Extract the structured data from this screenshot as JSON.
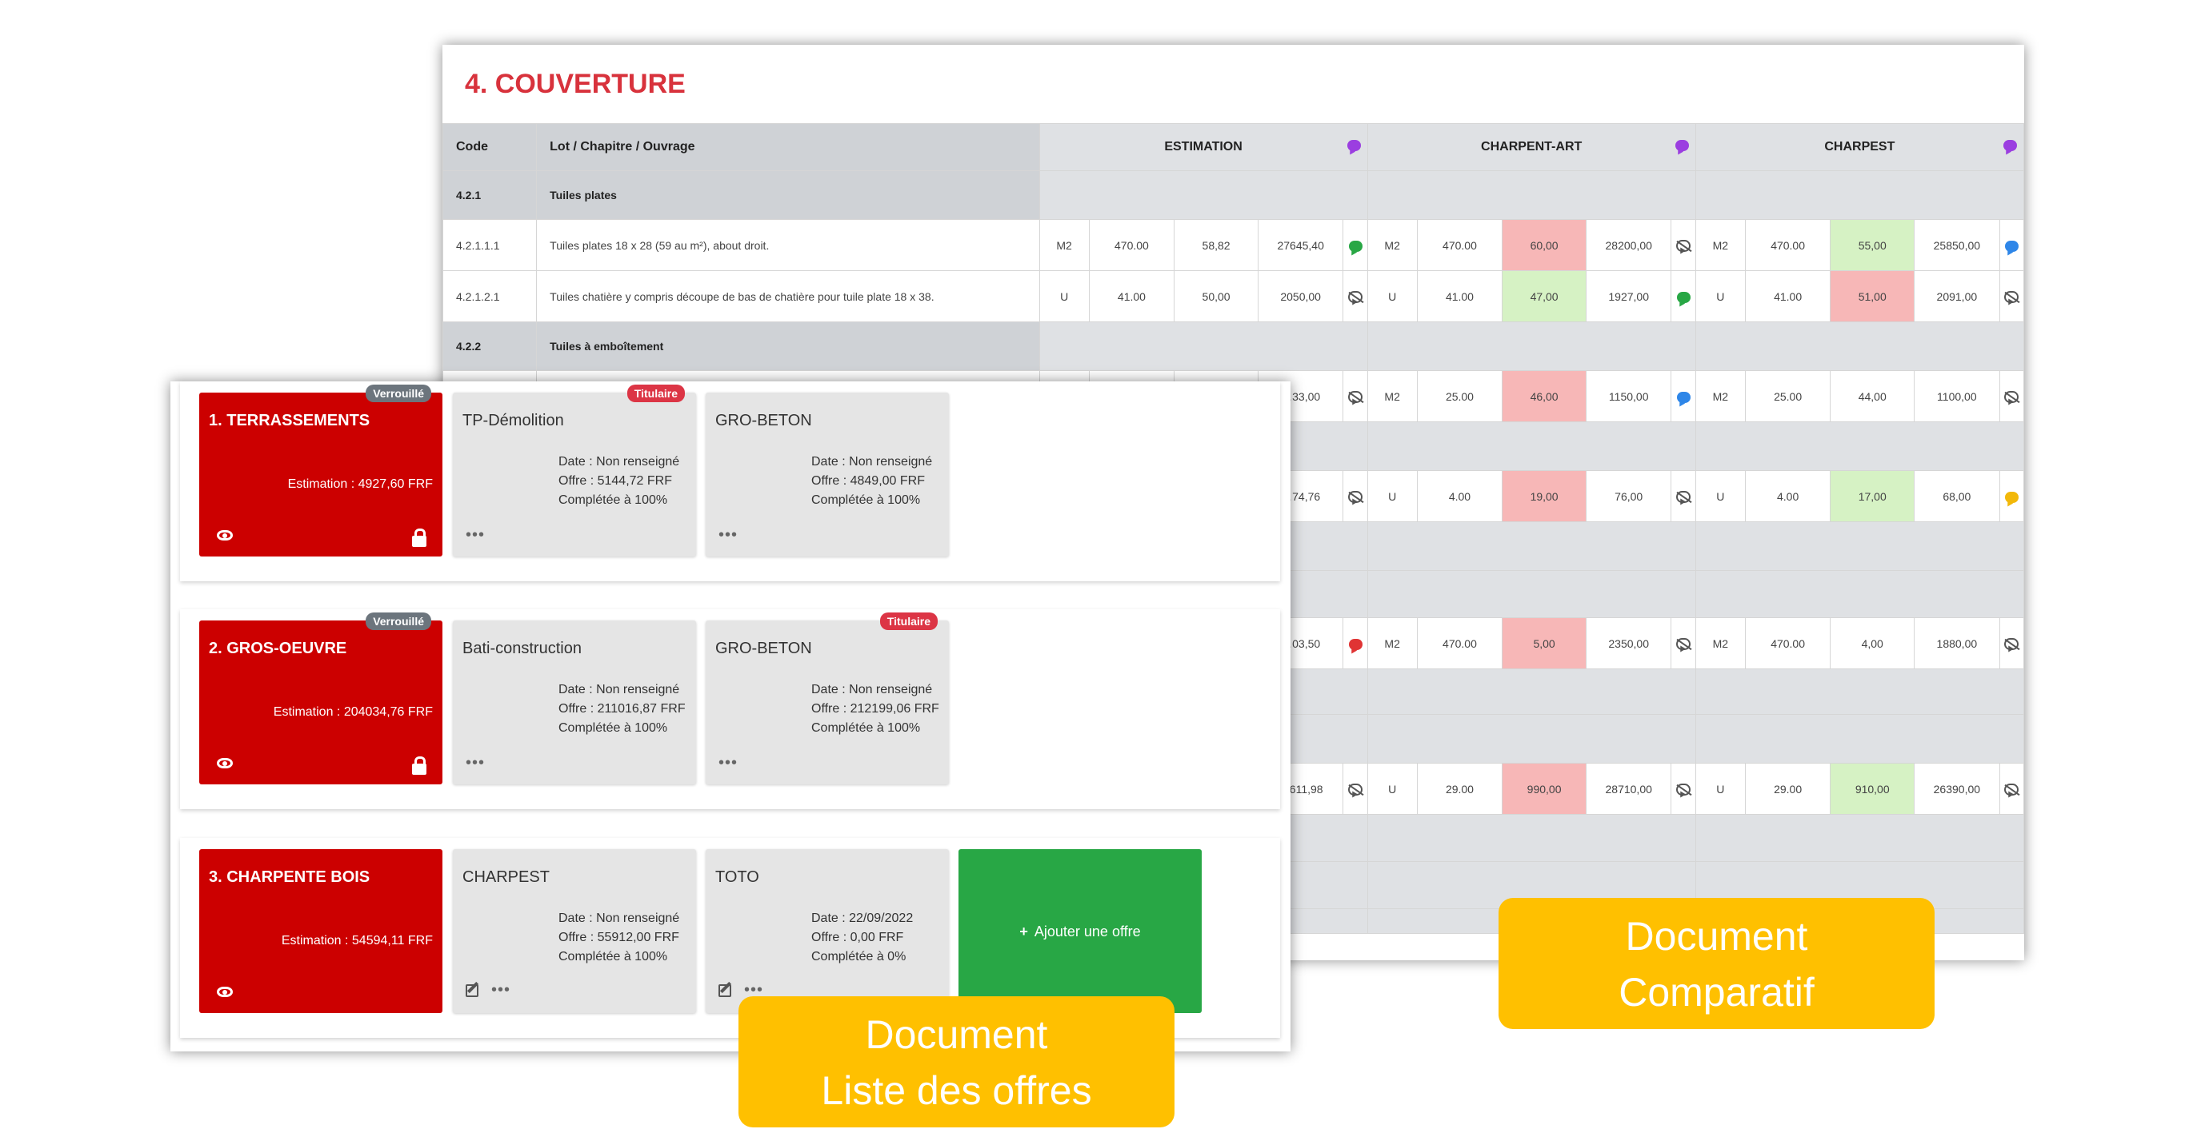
{
  "comparatif": {
    "title": "4. COUVERTURE",
    "headers": {
      "code": "Code",
      "lot": "Lot / Chapitre / Ouvrage"
    },
    "companies": [
      {
        "name": "ESTIMATION",
        "icon": "purple-comment-icon"
      },
      {
        "name": "CHARPENT-ART",
        "icon": "purple-comment-icon"
      },
      {
        "name": "CHARPEST",
        "icon": "purple-comment-icon"
      }
    ],
    "chapters": [
      {
        "code": "4.2.1",
        "label": "Tuiles plates"
      },
      {
        "code": "4.2.2",
        "label": "Tuiles à emboîtement"
      }
    ],
    "items": [
      {
        "code": "4.2.1.1.1",
        "label": "Tuiles plates 18 x 28 (59 au m²), about droit.",
        "estimation": {
          "unit": "M2",
          "qty": "470.00",
          "pu": "58,82",
          "total": "27645,40",
          "icon": "green"
        },
        "charpentart": {
          "unit": "M2",
          "qty": "470.00",
          "pu": "60,00",
          "pu_color": "red",
          "total": "28200,00",
          "icon": "none"
        },
        "charpest": {
          "unit": "M2",
          "qty": "470.00",
          "pu": "55,00",
          "pu_color": "green",
          "total": "25850,00",
          "icon": "blue"
        }
      },
      {
        "code": "4.2.1.2.1",
        "label": "Tuiles chatière y compris découpe de bas de chatière pour tuile plate 18 x 38.",
        "estimation": {
          "unit": "U",
          "qty": "41.00",
          "pu": "50,00",
          "total": "2050,00",
          "icon": "none"
        },
        "charpentart": {
          "unit": "U",
          "qty": "41.00",
          "pu": "47,00",
          "pu_color": "green",
          "total": "1927,00",
          "icon": "green"
        },
        "charpest": {
          "unit": "U",
          "qty": "41.00",
          "pu": "51,00",
          "pu_color": "red",
          "total": "2091,00",
          "icon": "none"
        }
      }
    ],
    "partial_rows": [
      {
        "est_total": "…33,00",
        "est_icon": "none",
        "c1": {
          "unit": "M2",
          "qty": "25.00",
          "pu": "46,00",
          "pu_color": "red",
          "total": "1150,00",
          "icon": "blue"
        },
        "c2": {
          "unit": "M2",
          "qty": "25.00",
          "pu": "44,00",
          "pu_color": "",
          "total": "1100,00",
          "icon": "none"
        }
      },
      {
        "est_total": "…74,76",
        "est_icon": "none",
        "c1": {
          "unit": "U",
          "qty": "4.00",
          "pu": "19,00",
          "pu_color": "red",
          "total": "76,00",
          "icon": "none"
        },
        "c2": {
          "unit": "U",
          "qty": "4.00",
          "pu": "17,00",
          "pu_color": "green",
          "total": "68,00",
          "icon": "yellow"
        }
      },
      {
        "est_total": "…03,50",
        "est_icon": "red",
        "c1": {
          "unit": "M2",
          "qty": "470.00",
          "pu": "5,00",
          "pu_color": "red",
          "total": "2350,00",
          "icon": "none"
        },
        "c2": {
          "unit": "M2",
          "qty": "470.00",
          "pu": "4,00",
          "pu_color": "",
          "total": "1880,00",
          "icon": "none"
        }
      },
      {
        "est_total": "…611,98",
        "est_icon": "none",
        "c1": {
          "unit": "U",
          "qty": "29.00",
          "pu": "990,00",
          "pu_color": "red",
          "total": "28710,00",
          "icon": "none"
        },
        "c2": {
          "unit": "U",
          "qty": "29.00",
          "pu": "910,00",
          "pu_color": "green",
          "total": "26390,00",
          "icon": "none"
        }
      }
    ]
  },
  "liste": {
    "lots": [
      {
        "name": "1. TERRASSEMENTS",
        "estimation": "Estimation : 4927,60 FRF",
        "badge": "Verrouillé",
        "locked": true,
        "offers": [
          {
            "name": "TP-Démolition",
            "date": "Date : Non renseigné",
            "offre": "Offre : 5144,72 FRF",
            "completion": "Complétée à 100%",
            "badge": "Titulaire",
            "edit": false
          },
          {
            "name": "GRO-BETON",
            "date": "Date : Non renseigné",
            "offre": "Offre : 4849,00 FRF",
            "completion": "Complétée à 100%",
            "badge": "",
            "edit": false
          }
        ]
      },
      {
        "name": "2. GROS-OEUVRE",
        "estimation": "Estimation : 204034,76 FRF",
        "badge": "Verrouillé",
        "locked": true,
        "offers": [
          {
            "name": "Bati-construction",
            "date": "Date : Non renseigné",
            "offre": "Offre : 211016,87 FRF",
            "completion": "Complétée à 100%",
            "badge": "",
            "edit": false
          },
          {
            "name": "GRO-BETON",
            "date": "Date : Non renseigné",
            "offre": "Offre : 212199,06 FRF",
            "completion": "Complétée à 100%",
            "badge": "Titulaire",
            "edit": false
          }
        ]
      },
      {
        "name": "3. CHARPENTE BOIS",
        "estimation": "Estimation : 54594,11 FRF",
        "badge": "",
        "locked": false,
        "offers": [
          {
            "name": "CHARPEST",
            "date": "Date : Non renseigné",
            "offre": "Offre : 55912,00 FRF",
            "completion": "Complétée à 100%",
            "badge": "",
            "edit": true
          },
          {
            "name": "TOTO",
            "date": "Date : 22/09/2022",
            "offre": "Offre : 0,00 FRF",
            "completion": "Complétée à 0%",
            "badge": "",
            "edit": true
          }
        ],
        "add_label": "Ajouter une offre"
      }
    ]
  },
  "callouts": {
    "liste": [
      "Document",
      "Liste des offres"
    ],
    "comparatif": [
      "Document",
      "Comparatif"
    ]
  },
  "colors": {
    "lot_red": "#cc0000",
    "title_red": "#d8323c",
    "add_green": "#28a745",
    "callout": "#ffc000",
    "cell_red": "#f7b7b7",
    "cell_green": "#d6f2c4"
  }
}
